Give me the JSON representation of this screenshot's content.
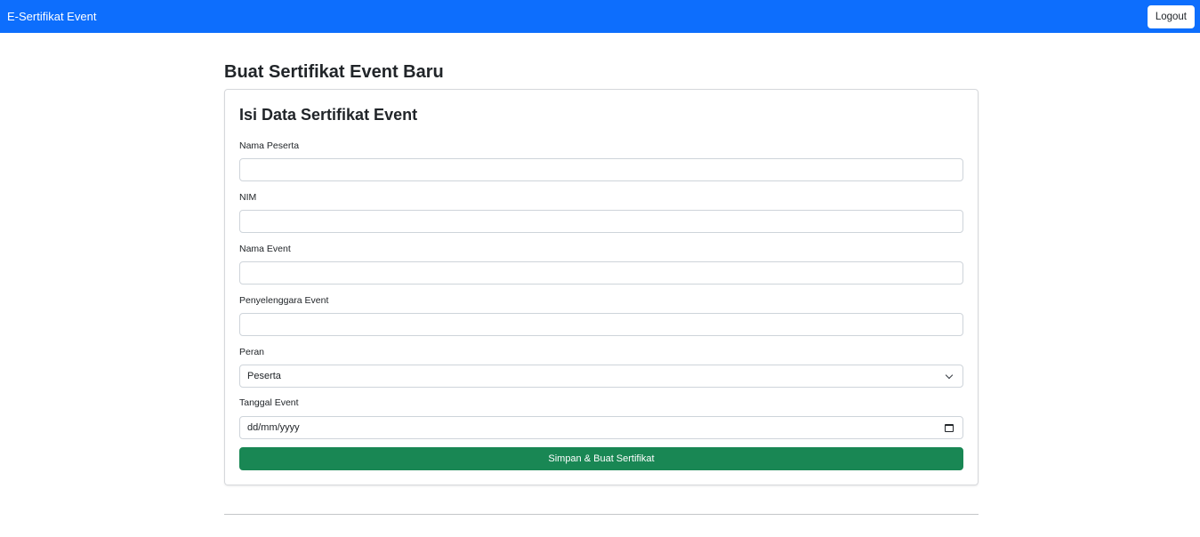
{
  "navbar": {
    "brand": "E-Sertifikat Event",
    "logout_label": "Logout"
  },
  "page": {
    "title": "Buat Sertifikat Event Baru"
  },
  "form": {
    "card_title": "Isi Data Sertifikat Event",
    "fields": [
      {
        "label": "Nama Peserta",
        "value": ""
      },
      {
        "label": "NIM",
        "value": ""
      },
      {
        "label": "Nama Event",
        "value": ""
      },
      {
        "label": "Penyelenggara Event",
        "value": ""
      },
      {
        "label": "Peran",
        "value": "Peserta"
      },
      {
        "label": "Tanggal Event",
        "value": "dd/mm/yyyy"
      }
    ],
    "submit_label": "Simpan & Buat Sertifikat"
  },
  "colors": {
    "navbar": "#0d6efd",
    "submit": "#198754"
  },
  "icons": {
    "select": "chevron-down-icon",
    "date": "calendar-icon"
  }
}
